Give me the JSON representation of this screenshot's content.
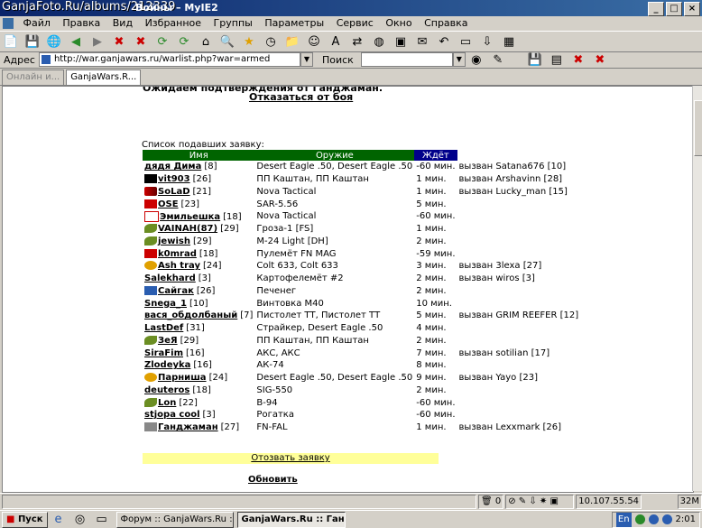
{
  "window": {
    "watermark": "GanjaFoto.Ru/albums/212339",
    "title": "Войны – MyIE2",
    "buttons": [
      "_",
      "□",
      "×"
    ]
  },
  "menu": [
    "Файл",
    "Правка",
    "Вид",
    "Избранное",
    "Группы",
    "Параметры",
    "Сервис",
    "Окно",
    "Справка"
  ],
  "address": {
    "label": "Адрес",
    "url": "http://war.ganjawars.ru/warlist.php?war=armed",
    "search_label": "Поиск"
  },
  "tabs": [
    {
      "label": "Онлайн и..."
    },
    {
      "label": "GanjaWars.R..."
    }
  ],
  "page": {
    "heading": "Ожидаем подтверждения от Ганджаман.",
    "cancel_link": "Отказаться от боя",
    "list_label": "Список подавших заявку:",
    "columns": [
      "Имя",
      "Оружие",
      "Ждёт"
    ],
    "header_colors": {
      "name": "#006400",
      "weapon": "#006400",
      "wait": "#00008b"
    },
    "rows": [
      {
        "name": "дядя Дима",
        "level": "[8]",
        "weapon": "Desert Eagle .50, Desert Eagle .50",
        "wait": "-60 мин.",
        "note": "вызван Satana676 [10]",
        "badge": "none"
      },
      {
        "name": "vit903",
        "level": "[26]",
        "weapon": "ПП Каштан, ПП Каштан",
        "wait": "1 мин.",
        "note": "вызван Arshavinn [28]",
        "badge": "black"
      },
      {
        "name": "SoLaD",
        "level": "[21]",
        "weapon": "Nova Tactical",
        "wait": "1 мин.",
        "note": "вызван Lucky_man [15]",
        "badge": "arrow"
      },
      {
        "name": "OSE",
        "level": "[23]",
        "weapon": "SAR-5.56",
        "wait": "5 мин.",
        "note": "",
        "badge": "gm"
      },
      {
        "name": "Эмильешка",
        "level": "[18]",
        "weapon": "Nova Tactical",
        "wait": "-60 мин.",
        "note": "",
        "badge": "oz"
      },
      {
        "name": "VAINAH(87)",
        "level": "[29]",
        "weapon": "Гроза-1 [FS]",
        "wait": "1 мин.",
        "note": "",
        "badge": "leaf"
      },
      {
        "name": "jewish",
        "level": "[29]",
        "weapon": "M-24 Light [DH]",
        "wait": "2 мин.",
        "note": "",
        "badge": "leaf"
      },
      {
        "name": "k0mrad",
        "level": "[18]",
        "weapon": "Пулемёт FN MAG",
        "wait": "-59 мин.",
        "note": "",
        "badge": "red"
      },
      {
        "name": "Ash tray",
        "level": "[24]",
        "weapon": "Colt 633, Colt 633",
        "wait": "3 мин.",
        "note": "вызван 3lexa [27]",
        "badge": "info"
      },
      {
        "name": "Salekhard",
        "level": "[3]",
        "weapon": "Картофелемёт #2",
        "wait": "2 мин.",
        "note": "вызван wiros [3]",
        "badge": "none"
      },
      {
        "name": "Сайгак",
        "level": "[26]",
        "weapon": "Печенег",
        "wait": "2 мин.",
        "note": "",
        "badge": "blue"
      },
      {
        "name": "Snega_1",
        "level": "[10]",
        "weapon": "Винтовка M40",
        "wait": "10 мин.",
        "note": "",
        "badge": "none"
      },
      {
        "name": "вася_обдолбаный",
        "level": "[7]",
        "weapon": "Пистолет ТТ, Пистолет ТТ",
        "wait": "5 мин.",
        "note": "вызван GRIM REEFER [12]",
        "badge": "none"
      },
      {
        "name": "LastDef",
        "level": "[31]",
        "weapon": "Страйкер, Desert Eagle .50",
        "wait": "4 мин.",
        "note": "",
        "badge": "none"
      },
      {
        "name": "ЗеЯ",
        "level": "[29]",
        "weapon": "ПП Каштан, ПП Каштан",
        "wait": "2 мин.",
        "note": "",
        "badge": "leaf"
      },
      {
        "name": "SiraFim",
        "level": "[16]",
        "weapon": "АКС, АКС",
        "wait": "7 мин.",
        "note": "вызван sotilian [17]",
        "badge": "none"
      },
      {
        "name": "Zlodeyka",
        "level": "[16]",
        "weapon": "АК-74",
        "wait": "8 мин.",
        "note": "",
        "badge": "none"
      },
      {
        "name": "Парниша",
        "level": "[24]",
        "weapon": "Desert Eagle .50, Desert Eagle .50",
        "wait": "9 мин.",
        "note": "вызван Yayo [23]",
        "badge": "info"
      },
      {
        "name": "deuteros",
        "level": "[18]",
        "weapon": "SIG-550",
        "wait": "2 мин.",
        "note": "",
        "badge": "none"
      },
      {
        "name": "Lon",
        "level": "[22]",
        "weapon": "B-94",
        "wait": "-60 мин.",
        "note": "",
        "badge": "leaf"
      },
      {
        "name": "stjopa cool",
        "level": "[3]",
        "weapon": "Рогатка",
        "wait": "-60 мин.",
        "note": "",
        "badge": "none"
      },
      {
        "name": "Ганджаман",
        "level": "[27]",
        "weapon": "FN-FAL",
        "wait": "1 мин.",
        "note": "вызван Lexxmark [26]",
        "badge": "gray"
      }
    ],
    "withdraw_link": "Отозвать заявку",
    "refresh_link": "Обновить"
  },
  "status": {
    "count": "0",
    "ip": "10.107.55.54",
    "mem": "32M"
  },
  "taskbar": {
    "start": "Пуск",
    "tasks": [
      {
        "label": "Форум :: GanjaWars.Ru ::"
      },
      {
        "label": "GanjaWars.Ru :: Ган..."
      }
    ],
    "lang": "En",
    "clock": "2:01"
  }
}
